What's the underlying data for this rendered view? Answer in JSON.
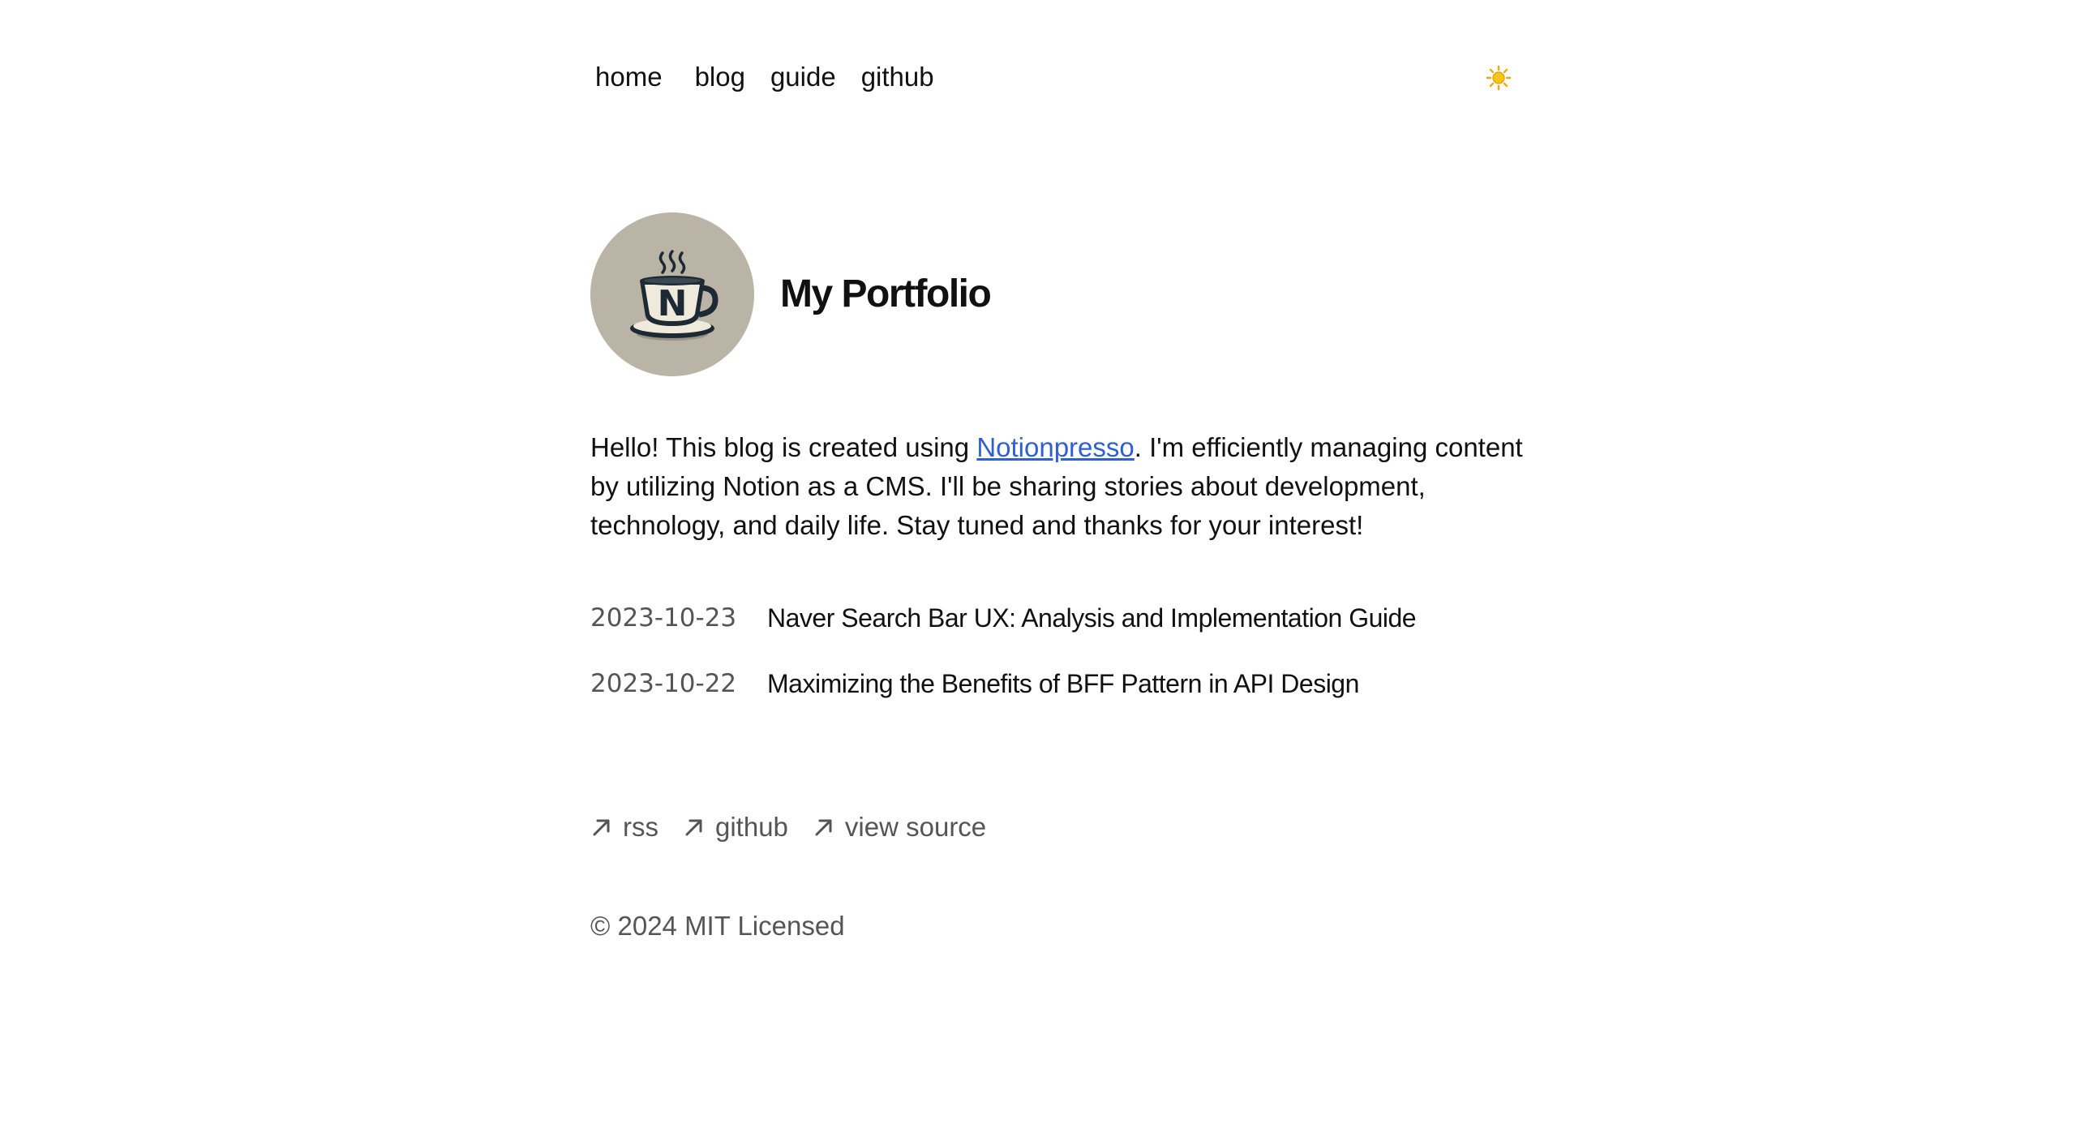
{
  "nav": {
    "items": [
      {
        "label": "home"
      },
      {
        "label": "blog"
      },
      {
        "label": "guide"
      },
      {
        "label": "github"
      }
    ],
    "theme_icon": "sun-icon"
  },
  "profile": {
    "avatar_icon": "coffee-cup-logo-icon",
    "avatar_letter": "N",
    "title": "My Portfolio"
  },
  "intro": {
    "before_link": "Hello! This blog is created using ",
    "link_text": "Notionpresso",
    "after_link": ". I'm efficiently managing content by utilizing Notion as a CMS. I'll be sharing stories about development, technology, and daily life. Stay tuned and thanks for your interest!"
  },
  "posts": [
    {
      "date": "2023-10-23",
      "title": "Naver Search Bar UX: Analysis and Implementation Guide"
    },
    {
      "date": "2023-10-22",
      "title": "Maximizing the Benefits of BFF Pattern in API Design"
    }
  ],
  "footer": {
    "links": [
      {
        "label": "rss",
        "icon": "arrow-up-right-icon"
      },
      {
        "label": "github",
        "icon": "arrow-up-right-icon"
      },
      {
        "label": "view source",
        "icon": "arrow-up-right-icon"
      }
    ],
    "copyright": "© 2024 MIT Licensed"
  },
  "colors": {
    "link": "#2f5fd6",
    "text": "#111111",
    "muted": "#555555",
    "avatar_bg": "#b9b4a6",
    "sun": "#f5b400"
  }
}
